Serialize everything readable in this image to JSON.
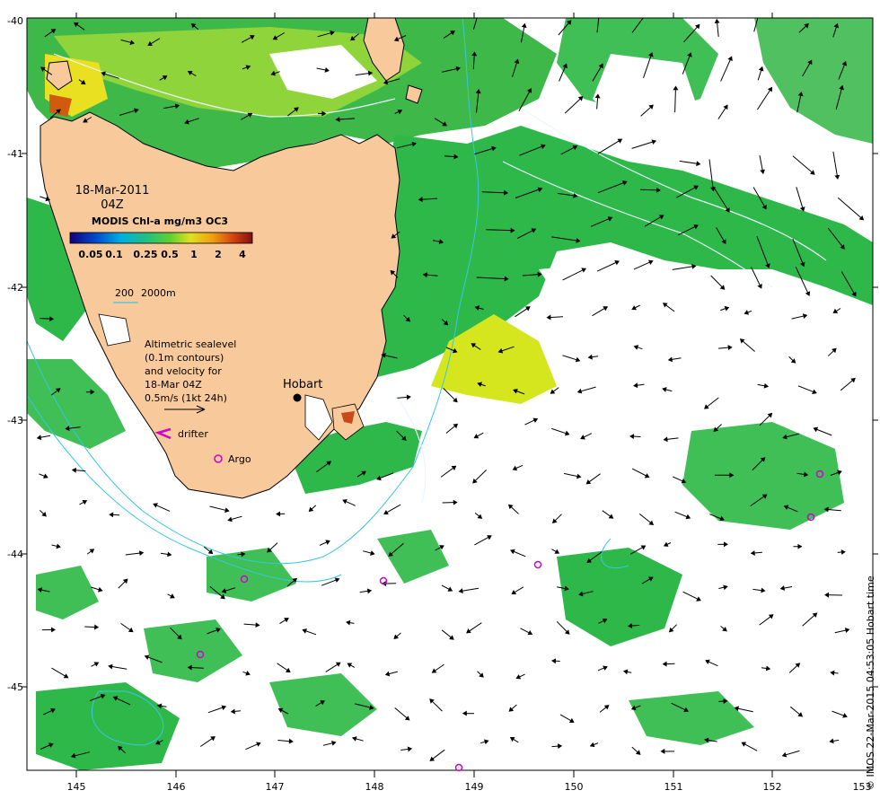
{
  "map": {
    "x_axis_ticks": [
      "145",
      "146",
      "147",
      "148",
      "149",
      "150",
      "151",
      "152",
      "153"
    ],
    "y_axis_ticks": [
      "-40",
      "-41",
      "-42",
      "-43",
      "-44",
      "-45"
    ],
    "date_label": "18-Mar-2011",
    "time_label": "04Z",
    "colorbar_title": "MODIS Chl-a mg/m3 OC3",
    "colorbar_ticks": [
      "0.05",
      "0.1",
      "0.25",
      "0.5",
      "1",
      "2",
      "4"
    ],
    "isobath_label_1": "200",
    "isobath_label_2": "2000m",
    "sealevel_lines": [
      "Altimetric sealevel",
      "(0.1m contours)",
      "and velocity for",
      "18-Mar 04Z",
      "0.5m/s (1kt 24h)"
    ],
    "drifter_label": "drifter",
    "argo_label": "Argo",
    "city_label": "Hobart",
    "credit": "© IMOS 22-Mar-2015 04:53:05 Hobart time",
    "colors": {
      "land": "#f8c99a",
      "chl_mid": "#2fb84a",
      "chl_high": "#d6e61e",
      "isobath": "#37c7e3",
      "argo": "#d000d0"
    }
  }
}
